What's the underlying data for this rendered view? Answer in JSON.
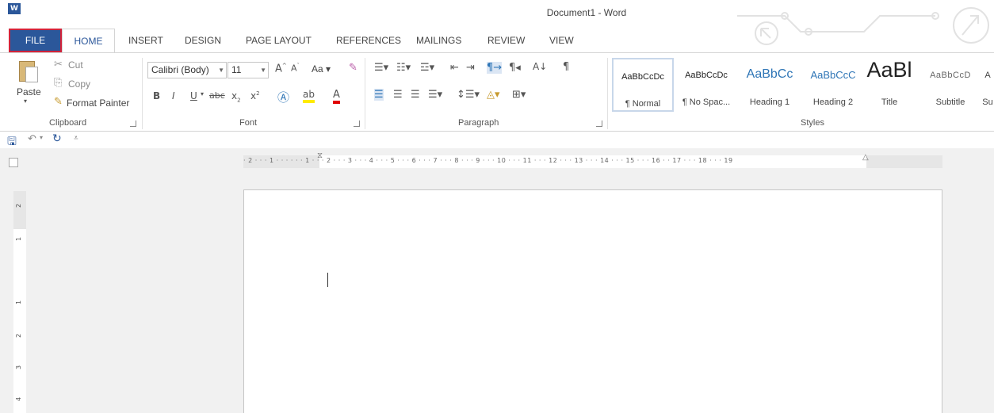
{
  "title": "Document1 - Word",
  "app_logo": "W",
  "tabs": {
    "file": "FILE",
    "home": "HOME",
    "items": [
      "INSERT",
      "DESIGN",
      "PAGE LAYOUT",
      "REFERENCES",
      "MAILINGS",
      "REVIEW",
      "VIEW"
    ]
  },
  "clipboard": {
    "label": "Clipboard",
    "paste": "Paste",
    "cut": "Cut",
    "copy": "Copy",
    "format_painter": "Format Painter"
  },
  "font": {
    "label": "Font",
    "font_name": "Calibri (Body)",
    "font_size": "11",
    "change_case": "Aa"
  },
  "paragraph": {
    "label": "Paragraph"
  },
  "styles": {
    "label": "Styles",
    "items": [
      {
        "sample": "AaBbCcDc",
        "name": "¶ Normal"
      },
      {
        "sample": "AaBbCcDc",
        "name": "¶ No Spac..."
      },
      {
        "sample": "AaBbCc",
        "name": "Heading 1"
      },
      {
        "sample": "AaBbCcC",
        "name": "Heading 2"
      },
      {
        "sample": "AaBl",
        "name": "Title"
      },
      {
        "sample": "AaBbCcD",
        "name": "Subtitle"
      },
      {
        "sample": "A",
        "name": "Su"
      }
    ]
  },
  "ruler": {
    "h_labels": "· 2 · · · 1 · · ·  ·  · · 1 · · · 2 · · · 3 · · · 4 · · · 5 · · · 6 · · · 7 · · · 8 · · · 9 · · · 10 · · · 11 · · · 12 · · · 13 · · · 14 · · · 15 · · · 16 ·  · 17 · · · 18 · · · 19",
    "v_labels": [
      "2",
      "1",
      "1",
      "2",
      "3",
      "4"
    ]
  },
  "colors": {
    "accent": "#2b579a",
    "file_highlight": "#d2233a",
    "workspace": "#f1f1f1"
  }
}
